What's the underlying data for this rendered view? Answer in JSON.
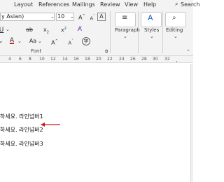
{
  "menu": {
    "items": [
      "Layout",
      "References",
      "Mailings",
      "Review",
      "View",
      "Help"
    ],
    "search": "Search"
  },
  "font": {
    "name_value": "y Asian)",
    "size_value": "10",
    "group_label": "Font",
    "font_color_hex": "#d62020"
  },
  "ribbon": {
    "paragraph_label": "Paragraph",
    "styles_label": "Styles",
    "editing_label": "Editing"
  },
  "ruler": {
    "ticks": [
      "4",
      "6",
      "8",
      "10",
      "12",
      "14",
      "16",
      "18",
      "20",
      "22",
      "24",
      "26",
      "28",
      "30",
      "32"
    ]
  },
  "document": {
    "lines": [
      "하세요. 라인넘버1",
      "하세요. 라인넘버2",
      "하세요. 라인넘버3"
    ],
    "arrow_color": "#cc1d1d"
  }
}
